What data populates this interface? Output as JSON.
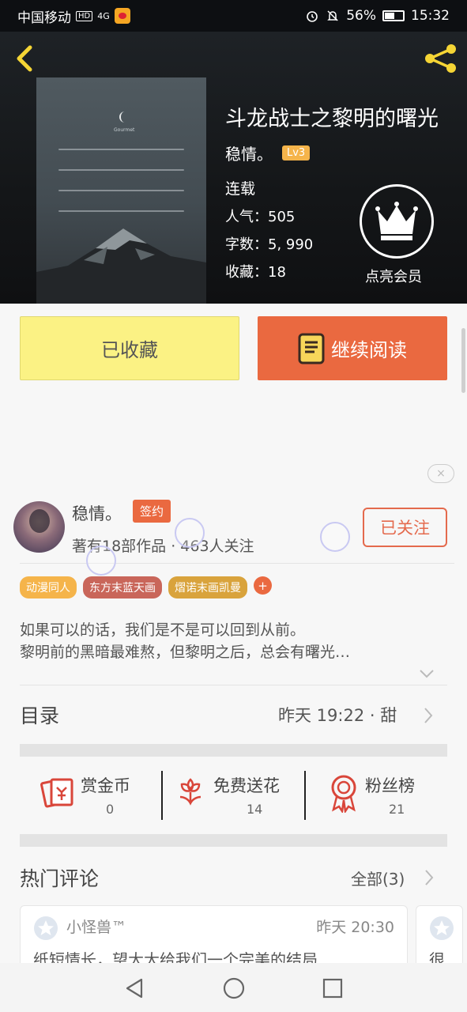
{
  "status_bar": {
    "carrier": "中国移动",
    "hd": "HD",
    "network": "4G",
    "battery_text": "56%",
    "battery_level": 0.56,
    "time": "15:32"
  },
  "book": {
    "title": "斗龙战士之黎明的曙光",
    "author": "稳情。",
    "level": "Lv3",
    "status": "连载",
    "popularity": "人气：505",
    "word_count": "字数：5, 990",
    "favorites": "收藏：18",
    "vip_label": "点亮会员",
    "cover_caption": "Gourmet"
  },
  "actions": {
    "favorited": "已收藏",
    "continue_reading": "继续阅读"
  },
  "ad": {
    "close": "×"
  },
  "author_card": {
    "name": "稳情。",
    "badge": "签约",
    "meta": "著有18部作品 · 463人关注",
    "follow": "已关注"
  },
  "tags": [
    {
      "label": "动漫同人",
      "color": "#f5b44a"
    },
    {
      "label": "东方末蓝天画",
      "color": "#c9665a"
    },
    {
      "label": "熠诺末画凯曼",
      "color": "#d9a33c"
    }
  ],
  "tag_add": "+",
  "intro": {
    "line1": "如果可以的话，我们是不是可以回到从前。",
    "line2": "黎明前的黑暗最难熬，但黎明之后，总会有曙光…"
  },
  "toc": {
    "label": "目录",
    "info": "昨天 19:22 · 甜"
  },
  "gifts": [
    {
      "label": "赏金币",
      "count": "0"
    },
    {
      "label": "免费送花",
      "count": "14"
    },
    {
      "label": "粉丝榜",
      "count": "21"
    }
  ],
  "hot_comments": {
    "title": "热门评论",
    "all": "全部(3)",
    "items": [
      {
        "user": "小怪兽™",
        "time": "昨天 20:30",
        "text": "纸短情长，望大大给我们一个完美的结局"
      },
      {
        "user": "",
        "time": "",
        "text": "很"
      }
    ]
  },
  "colors": {
    "accent": "#ea6940",
    "favorite_bg": "#fbf284",
    "header_bg": "#141618",
    "level_badge": "#f5b44a"
  },
  "icons": [
    "back-icon",
    "share-icon",
    "crown-icon",
    "book-icon",
    "close-icon",
    "chevron-down-icon",
    "chevron-right-icon",
    "red-envelope-icon",
    "flower-icon",
    "medal-icon",
    "star-avatar-icon",
    "nav-back-icon",
    "nav-home-icon",
    "nav-recent-icon"
  ]
}
